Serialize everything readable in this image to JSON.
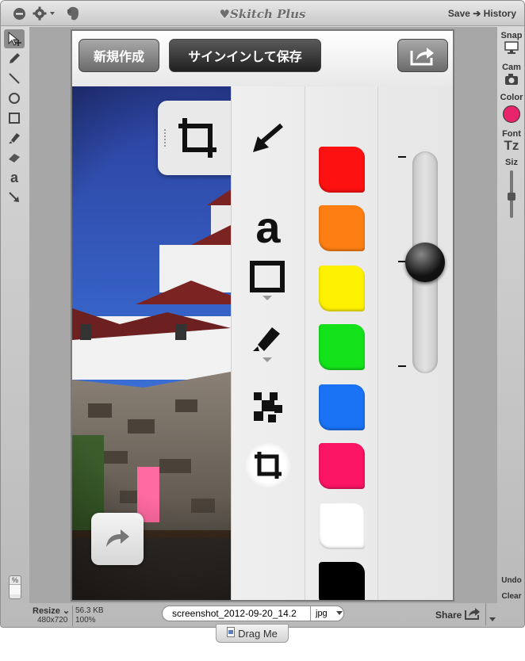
{
  "app": {
    "title": "Skitch Plus",
    "save_label": "Save",
    "history_label": "History"
  },
  "left_toolbar": {
    "tools": [
      {
        "name": "select-tool-icon",
        "glyph": "↖"
      },
      {
        "name": "pencil-tool-icon",
        "glyph": "✎"
      },
      {
        "name": "line-tool-icon",
        "glyph": "╲"
      },
      {
        "name": "ellipse-tool-icon",
        "glyph": "○"
      },
      {
        "name": "rectangle-tool-icon",
        "glyph": "□"
      },
      {
        "name": "highlighter-tool-icon",
        "glyph": "✐"
      },
      {
        "name": "eraser-tool-icon",
        "glyph": "▰"
      },
      {
        "name": "text-tool-icon",
        "glyph": "a"
      },
      {
        "name": "arrow-tool-icon",
        "glyph": "➘"
      }
    ],
    "percent_label": "%"
  },
  "right_panel": {
    "snap_label": "Snap",
    "cam_label": "Cam",
    "color_label": "Color",
    "color_value": "#e8246a",
    "font_label": "Font",
    "font_glyph": "Tz",
    "size_label": "Siz",
    "undo_label": "Undo",
    "clear_label": "Clear"
  },
  "phone": {
    "new_button": "新規作成",
    "signin_save_button": "サインインして保存",
    "swatches": [
      "#fe1111",
      "#fd7e12",
      "#fff200",
      "#13e21b",
      "#1a72f5",
      "#fc1465",
      "#ffffff",
      "#000000"
    ],
    "text_tool_glyph": "a",
    "slider_level": 0.5
  },
  "bottom": {
    "resize_label": "Resize",
    "dimensions": "480x720",
    "file_size": "56.3 KB",
    "zoom": "100%",
    "filename": "screenshot_2012-09-20_14.2",
    "format": "jpg",
    "share_label": "Share",
    "drag_label": "Drag Me"
  }
}
